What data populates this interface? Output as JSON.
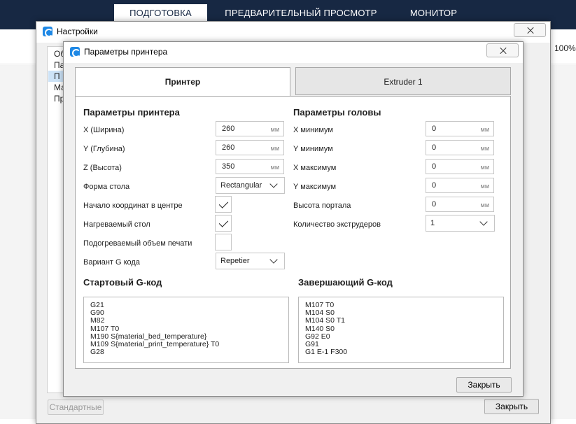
{
  "app": {
    "stage_tabs": [
      {
        "label": "ПОДГОТОВКА",
        "active": true
      },
      {
        "label": "ПРЕДВАРИТЕЛЬНЫЙ ПРОСМОТР",
        "active": false
      },
      {
        "label": "МОНИТОР",
        "active": false
      }
    ],
    "zoom": "100%",
    "colors": {
      "topbar": "#172843",
      "accent": "#1e88e5"
    }
  },
  "settings_window": {
    "title": "Настройки",
    "icon": "cura-logo-icon",
    "sidebar_items": [
      "Об",
      "Па",
      "П",
      "Ма",
      "Пр"
    ],
    "selected_index": 2,
    "defaults_button": "Стандартные",
    "close_button": "Закрыть"
  },
  "printer_dialog": {
    "title": "Параметры принтера",
    "icon": "cura-logo-icon",
    "tabs": [
      {
        "label": "Принтер",
        "active": true
      },
      {
        "label": "Extruder 1",
        "active": false
      }
    ],
    "printer_section": {
      "title": "Параметры принтера",
      "width": {
        "label": "X (Ширина)",
        "value": "260",
        "unit": "мм"
      },
      "depth": {
        "label": "Y (Глубина)",
        "value": "260",
        "unit": "мм"
      },
      "height": {
        "label": "Z (Высота)",
        "value": "350",
        "unit": "мм"
      },
      "bed_shape": {
        "label": "Форма стола",
        "value": "Rectangular"
      },
      "origin_center": {
        "label": "Начало координат в центре",
        "checked": true
      },
      "heated_bed": {
        "label": "Нагреваемый стол",
        "checked": true
      },
      "heated_volume": {
        "label": "Подогреваемый объем печати",
        "checked": false
      },
      "gcode_flavor": {
        "label": "Вариант G кода",
        "value": "Repetier"
      }
    },
    "head_section": {
      "title": "Параметры головы",
      "x_min": {
        "label": "X минимум",
        "value": "0",
        "unit": "мм"
      },
      "y_min": {
        "label": "Y минимум",
        "value": "0",
        "unit": "мм"
      },
      "x_max": {
        "label": "X максимум",
        "value": "0",
        "unit": "мм"
      },
      "y_max": {
        "label": "Y максимум",
        "value": "0",
        "unit": "мм"
      },
      "gantry_height": {
        "label": "Высота портала",
        "value": "0",
        "unit": "мм"
      },
      "extruder_count": {
        "label": "Количество экструдеров",
        "value": "1"
      }
    },
    "start_gcode": {
      "title": "Стартовый G-код",
      "lines": [
        "G21",
        "G90",
        "M82",
        "M107 T0",
        "M190 S{material_bed_temperature}",
        "M109 S{material_print_temperature} T0",
        "G28"
      ]
    },
    "end_gcode": {
      "title": "Завершающий G-код",
      "lines": [
        "M107 T0",
        "M104 S0",
        "M104 S0 T1",
        "M140 S0",
        "G92 E0",
        "G91",
        "G1 E-1 F300"
      ]
    },
    "close_button": "Закрыть"
  }
}
